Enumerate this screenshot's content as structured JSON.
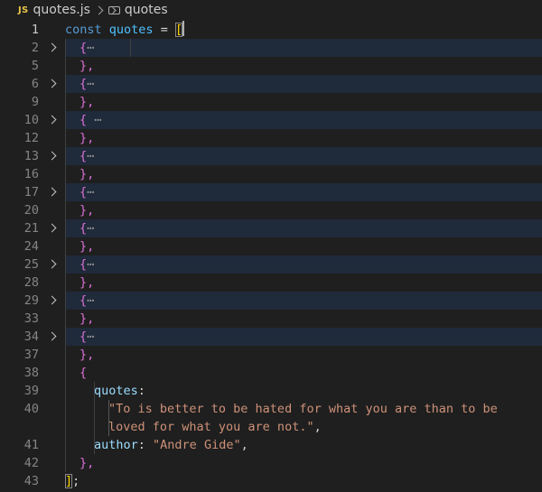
{
  "breadcrumb": {
    "file_icon": "JS",
    "file_name": "quotes.js",
    "symbol_icon": "symbol-variable-icon",
    "symbol_name": "quotes"
  },
  "editor": {
    "lines": [
      {
        "num": "1",
        "folded": false,
        "text_kw": "const",
        "text_var": "quotes",
        "text_op": " = ",
        "text_br": "["
      },
      {
        "num": "2",
        "folded": true,
        "brace": "{",
        "ellipsis": "⋯"
      },
      {
        "num": "5",
        "close": "},"
      },
      {
        "num": "6",
        "folded": true,
        "brace": "{",
        "ellipsis": "⋯"
      },
      {
        "num": "9",
        "close": "},"
      },
      {
        "num": "10",
        "folded": true,
        "brace": "{",
        "ellipsis": " ⋯"
      },
      {
        "num": "12",
        "close": "},"
      },
      {
        "num": "13",
        "folded": true,
        "brace": "{",
        "ellipsis": "⋯"
      },
      {
        "num": "16",
        "close": "},"
      },
      {
        "num": "17",
        "folded": true,
        "brace": "{",
        "ellipsis": "⋯"
      },
      {
        "num": "20",
        "close": "},"
      },
      {
        "num": "21",
        "folded": true,
        "brace": "{",
        "ellipsis": "⋯"
      },
      {
        "num": "24",
        "close": "},"
      },
      {
        "num": "25",
        "folded": true,
        "brace": "{",
        "ellipsis": "⋯"
      },
      {
        "num": "28",
        "close": "},"
      },
      {
        "num": "29",
        "folded": true,
        "brace": "{",
        "ellipsis": "⋯"
      },
      {
        "num": "33",
        "close": "},"
      },
      {
        "num": "34",
        "folded": true,
        "brace": "{",
        "ellipsis": "⋯"
      },
      {
        "num": "37",
        "close": "},"
      },
      {
        "num": "38",
        "brace": "{"
      },
      {
        "num": "39",
        "prop": "quotes",
        "colon": ":"
      },
      {
        "num": "40",
        "str_line1": "\"To is better to be hated for what you are than to be",
        "str_line2": "loved for what you are not.\"",
        "comma": ","
      },
      {
        "num": "41",
        "prop": "author",
        "colon": ": ",
        "str": "\"Andre Gide\"",
        "comma": ","
      },
      {
        "num": "42",
        "close": "},"
      },
      {
        "num": "43",
        "close_br": "]",
        "semi": ";"
      }
    ]
  }
}
